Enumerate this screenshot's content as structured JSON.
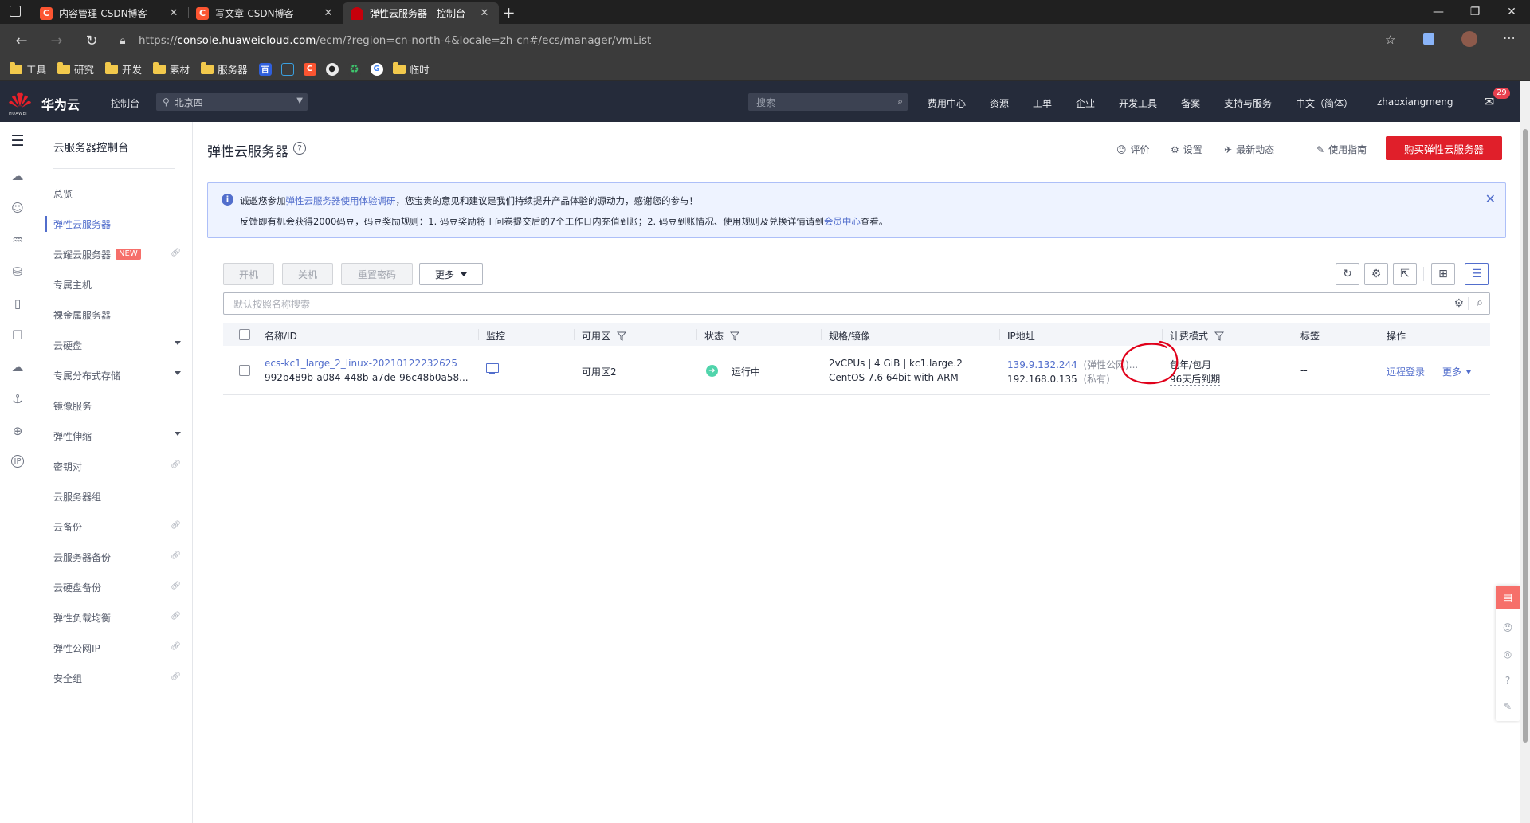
{
  "browser": {
    "tabs": [
      {
        "title": "内容管理-CSDN博客",
        "favicon": "C"
      },
      {
        "title": "写文章-CSDN博客",
        "favicon": "C"
      },
      {
        "title": "弹性云服务器 - 控制台",
        "favicon": "huawei"
      }
    ],
    "url_prefix": "https://",
    "url_host": "console.huaweicloud.com",
    "url_path": "/ecm/?region=cn-north-4&locale=zh-cn#/ecs/manager/vmList",
    "bookmarks": [
      "工具",
      "研究",
      "开发",
      "素材",
      "服务器",
      "临时"
    ]
  },
  "header": {
    "brand": "华为云",
    "logo_text": "HUAWEI",
    "console": "控制台",
    "region": "北京四",
    "search_placeholder": "搜索",
    "nav": [
      "费用中心",
      "资源",
      "工单",
      "企业",
      "开发工具",
      "备案",
      "支持与服务",
      "中文（简体）",
      "zhaoxiangmeng"
    ],
    "mail_count": "29"
  },
  "sidemenu": {
    "title": "云服务器控制台",
    "items": [
      {
        "label": "总览"
      },
      {
        "label": "弹性云服务器"
      },
      {
        "label": "云耀云服务器",
        "badge": "NEW"
      },
      {
        "label": "专属主机"
      },
      {
        "label": "裸金属服务器"
      },
      {
        "label": "云硬盘"
      },
      {
        "label": "专属分布式存储"
      },
      {
        "label": "镜像服务"
      },
      {
        "label": "弹性伸缩"
      },
      {
        "label": "密钥对"
      },
      {
        "label": "云服务器组"
      },
      {
        "label": "云备份"
      },
      {
        "label": "云服务器备份"
      },
      {
        "label": "云硬盘备份"
      },
      {
        "label": "弹性负载均衡"
      },
      {
        "label": "弹性公网IP"
      },
      {
        "label": "安全组"
      }
    ]
  },
  "main": {
    "title": "弹性云服务器",
    "actions": [
      "评价",
      "设置",
      "最新动态",
      "使用指南"
    ],
    "buy_button": "购买弹性云服务器",
    "notice": {
      "line1_pre": "诚邀您参加",
      "line1_link": "弹性云服务器使用体验调研",
      "line1_post": "，您宝贵的意见和建议是我们持续提升产品体验的源动力，感谢您的参与！",
      "line2_pre": "反馈即有机会获得2000码豆，码豆奖励规则：1. 码豆奖励将于问卷提交后的7个工作日内充值到账；2. 码豆到账情况、使用规则及兑换详情请到",
      "line2_link": "会员中心",
      "line2_post": "查看。"
    },
    "toolbar": {
      "start": "开机",
      "stop": "关机",
      "reset_pwd": "重置密码",
      "more": "更多"
    },
    "filter_placeholder": "默认按照名称搜索",
    "table": {
      "headers": [
        "名称/ID",
        "监控",
        "可用区",
        "状态",
        "规格/镜像",
        "IP地址",
        "计费模式",
        "标签",
        "操作"
      ],
      "rows": [
        {
          "name": "ecs-kc1_large_2_linux-20210122232625",
          "id": "992b489b-a084-448b-a7de-96c48b0a58...",
          "zone": "可用区2",
          "status": "运行中",
          "spec": "2vCPUs | 4 GiB | kc1.large.2",
          "image": "CentOS 7.6 64bit with ARM",
          "ip_public": "139.9.132.244",
          "ip_public_note": "(弹性公网)...",
          "ip_private": "192.168.0.135",
          "ip_private_note": "(私有)",
          "billing": "包年/包月",
          "billing_expire": "96天后到期",
          "tags": "--",
          "op_login": "远程登录",
          "op_more": "更多"
        }
      ]
    }
  },
  "colors": {
    "brand_red": "#e01f2a",
    "header_bg": "#252b3a",
    "link_blue": "#526ecc",
    "running_green": "#50d4ab",
    "annotation_red": "#e0001a"
  }
}
